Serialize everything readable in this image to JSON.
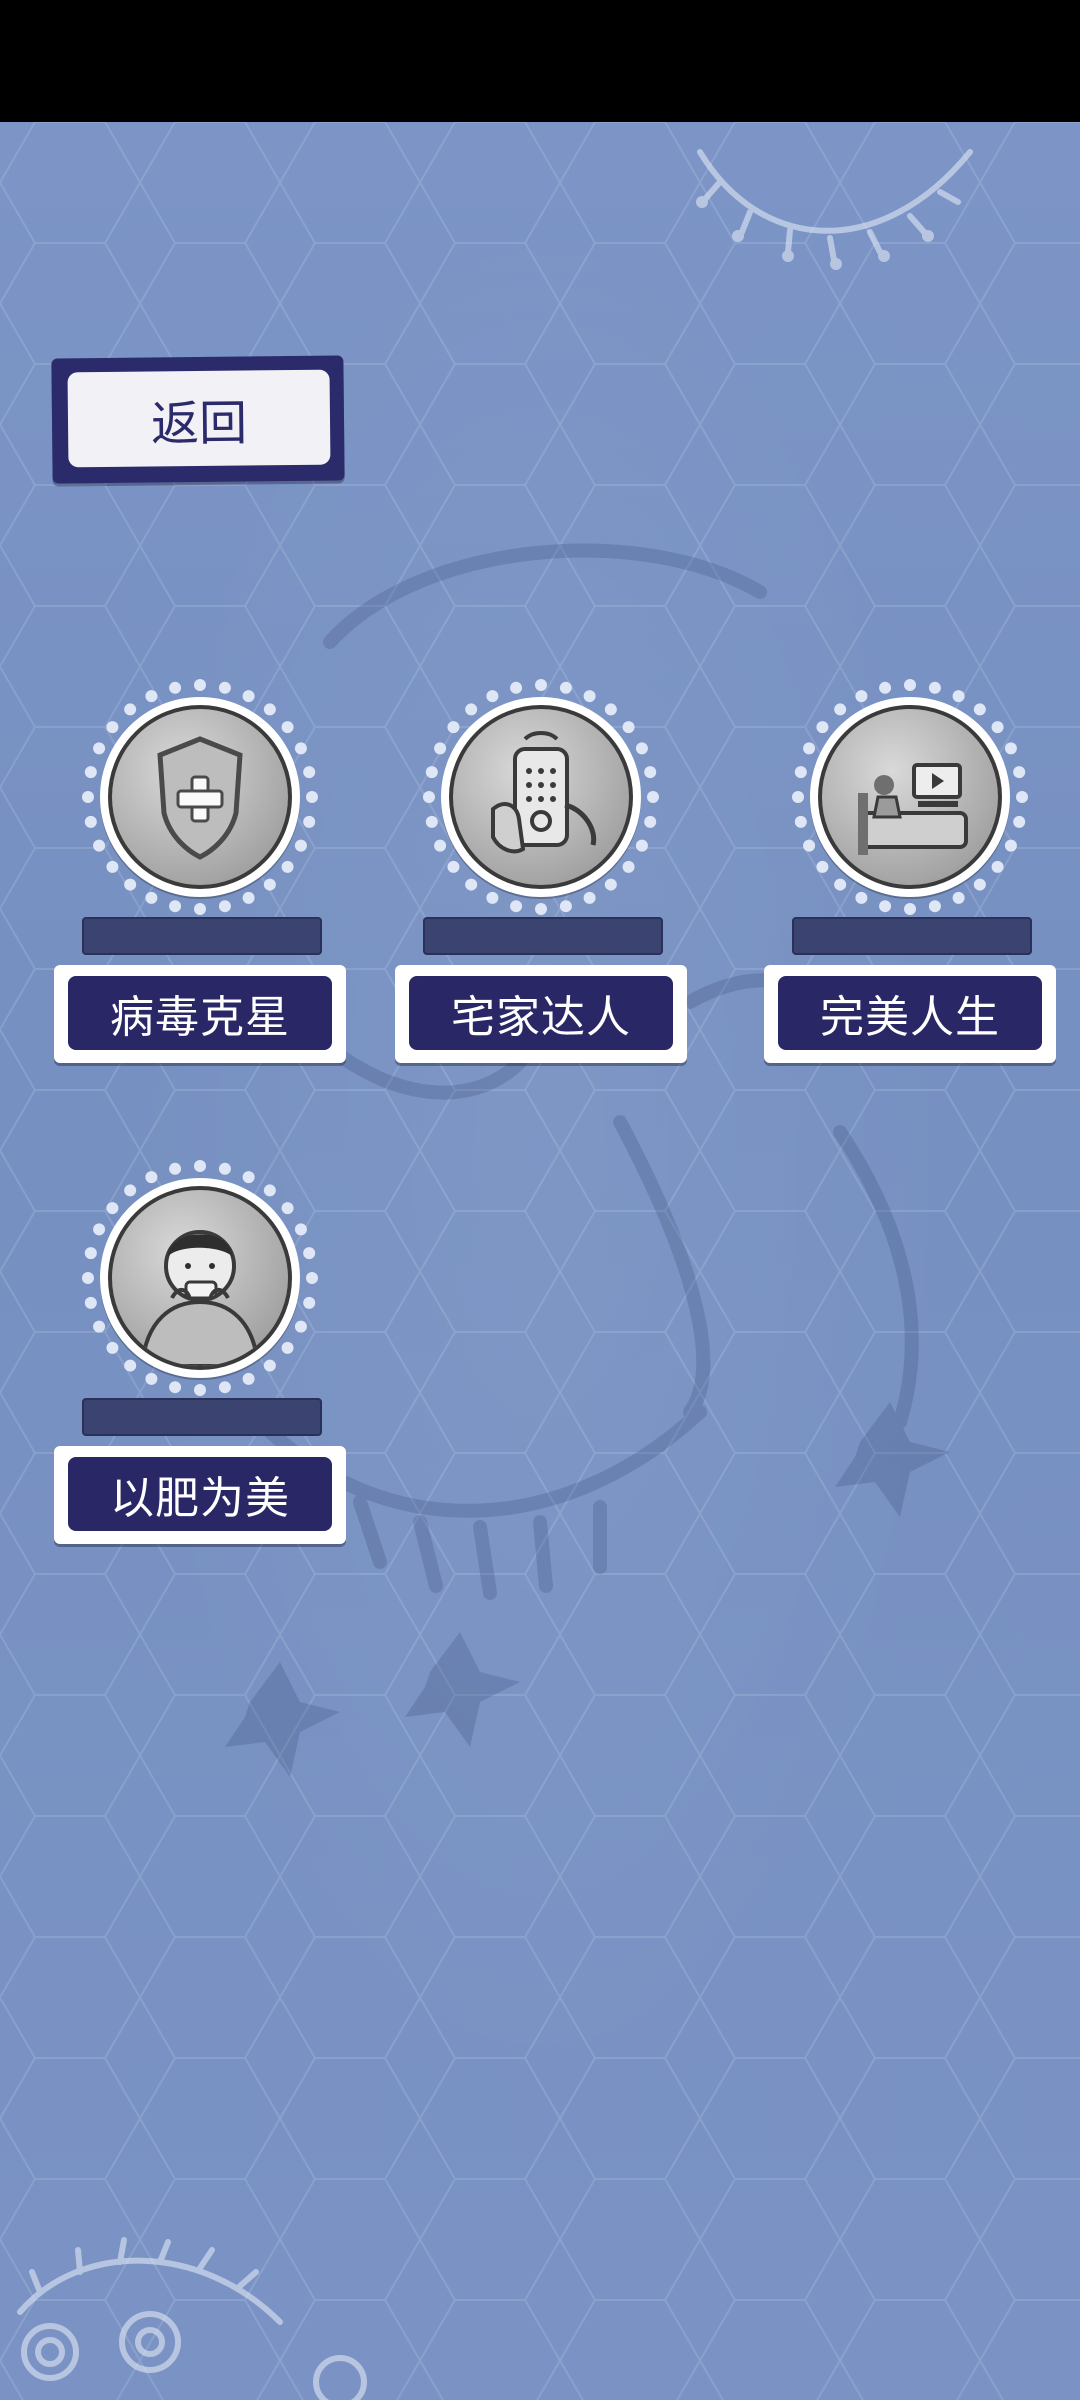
{
  "back_label": "返回",
  "colors": {
    "background": "#7a93c4",
    "label_fill": "#2a2766",
    "label_border": "#ffffff",
    "progress_fill": "#3b4470",
    "status_bar": "#000000"
  },
  "achievements": [
    {
      "name": "病毒克星",
      "icon": "shield-plus-icon",
      "progress": 0
    },
    {
      "name": "宅家达人",
      "icon": "phone-in-hand-icon",
      "progress": 0
    },
    {
      "name": "完美人生",
      "icon": "person-in-bed-watching-tv-icon",
      "progress": 0
    },
    {
      "name": "以肥为美",
      "icon": "boy-eating-icon",
      "progress": 0
    }
  ]
}
